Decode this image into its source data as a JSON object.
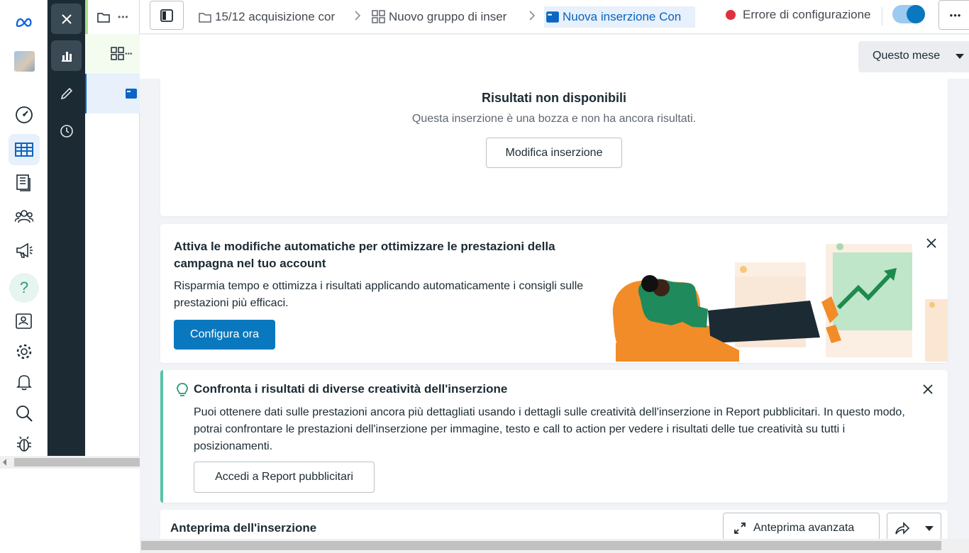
{
  "rail": {
    "items": [
      {
        "icon": "meta-logo-icon"
      },
      {
        "icon": "account-avatar"
      },
      {
        "icon": "speedometer-icon"
      },
      {
        "icon": "table-icon"
      },
      {
        "icon": "pages-icon"
      },
      {
        "icon": "audience-icon"
      },
      {
        "icon": "megaphone-icon"
      },
      {
        "icon": "help-icon",
        "label": "?"
      },
      {
        "icon": "contact-card-icon"
      },
      {
        "icon": "gear-icon"
      },
      {
        "icon": "bell-icon"
      },
      {
        "icon": "search-icon"
      },
      {
        "icon": "bug-icon"
      }
    ]
  },
  "tools": {
    "items": [
      {
        "icon": "close-icon"
      },
      {
        "icon": "bar-chart-icon"
      },
      {
        "icon": "pencil-icon"
      },
      {
        "icon": "clock-icon"
      }
    ]
  },
  "tree": {
    "campaign_icon": "folder-icon",
    "adset_icon": "grid-icon",
    "ad_icon": "ad-icon",
    "more_label": "•••"
  },
  "breadcrumb": {
    "campaign": "15/12 acquisizione cor",
    "adset": "Nuovo gruppo di inser",
    "ad": "Nuova inserzione Con"
  },
  "status": {
    "label": "Errore di configurazione",
    "dot_color": "#e0303e",
    "toggle_on": true
  },
  "more_button_label": "•••",
  "date_filter": {
    "label": "Questo mese"
  },
  "results_card": {
    "title": "Risultati non disponibili",
    "subtitle": "Questa inserzione è una bozza e non ha ancora risultati.",
    "button": "Modifica inserzione"
  },
  "auto_card": {
    "title": "Attiva le modifiche automatiche per ottimizzare le prestazioni della campagna nel tuo account",
    "body": "Risparmia tempo e ottimizza i risultati applicando automaticamente i consigli sulle prestazioni più efficaci.",
    "button": "Configura ora"
  },
  "compare_card": {
    "title": "Confronta i risultati di diverse creatività dell'inserzione",
    "body": "Puoi ottenere dati sulle prestazioni ancora più dettagliati usando i dettagli sulle creatività dell'inserzione in Report pubblicitari. In questo modo, potrai confrontare le prestazioni dell'inserzione per immagine, testo e call to action per vedere i risultati delle tue creatività su tutti i posizionamenti.",
    "button": "Accedi a Report pubblicitari",
    "accent": "#5ac2a7"
  },
  "preview_card": {
    "title": "Anteprima dell'inserzione",
    "advanced_button": "Anteprima avanzata"
  },
  "colors": {
    "primary": "#0a78be",
    "dark_sidebar": "#1c2b33"
  }
}
